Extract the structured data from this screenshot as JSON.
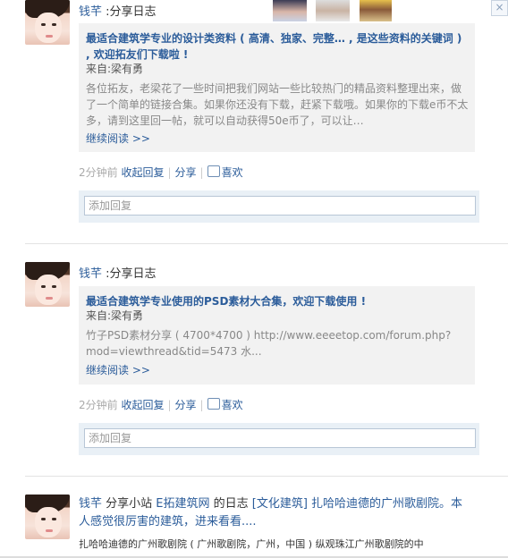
{
  "close_label": "×",
  "visitors": [
    "visitor-1",
    "visitor-2",
    "visitor-3"
  ],
  "posts": [
    {
      "author": "钱芊",
      "action": ":分享日志",
      "card_title": "最适合建筑学专业的设计类资料 ( 高清、独家、完整… , 是这些资料的关键词 ) , 欢迎拓友们下载啦 !",
      "from_label": "来自:",
      "from_name": "梁有勇",
      "body": "各位拓友，老梁花了一些时间把我们网站一些比较热门的精品资料整理出来，做了一个简单的链接合集。如果你还没有下载，赶紧下载哦。如果你的下载e币不太多，请到这里回一帖，就可以自动获得50e币了，可以让…",
      "more": "继续阅读 >>",
      "time": "2分钟前",
      "reply_label": "收起回复",
      "share_label": "分享",
      "like_label": "喜欢",
      "reply_placeholder": "添加回复"
    },
    {
      "author": "钱芊",
      "action": ":分享日志",
      "card_title": "最适合建筑学专业使用的PSD素材大合集，欢迎下载使用 !",
      "from_label": "来自:",
      "from_name": "梁有勇",
      "body": "竹子PSD素材分享 ( 4700*4700 )  http://www.eeeetop.com/forum.php?mod=viewthread&tid=5473 水...",
      "more": "继续阅读 >>",
      "time": "2分钟前",
      "reply_label": "收起回复",
      "share_label": "分享",
      "like_label": "喜欢",
      "reply_placeholder": "添加回复"
    },
    {
      "author": "钱芊",
      "action_prefix": " 分享小站 ",
      "site": "E拓建筑网",
      "action_mid": " 的日志 ",
      "tag": "[文化建筑]",
      "title": " 扎哈哈迪德的广州歌剧院。本人感觉很厉害的建筑，进来看看....",
      "body": "扎哈哈迪德的广州歌剧院 ( 广州歌剧院，广州，中国 )  纵观珠江广州歌剧院的中"
    }
  ]
}
